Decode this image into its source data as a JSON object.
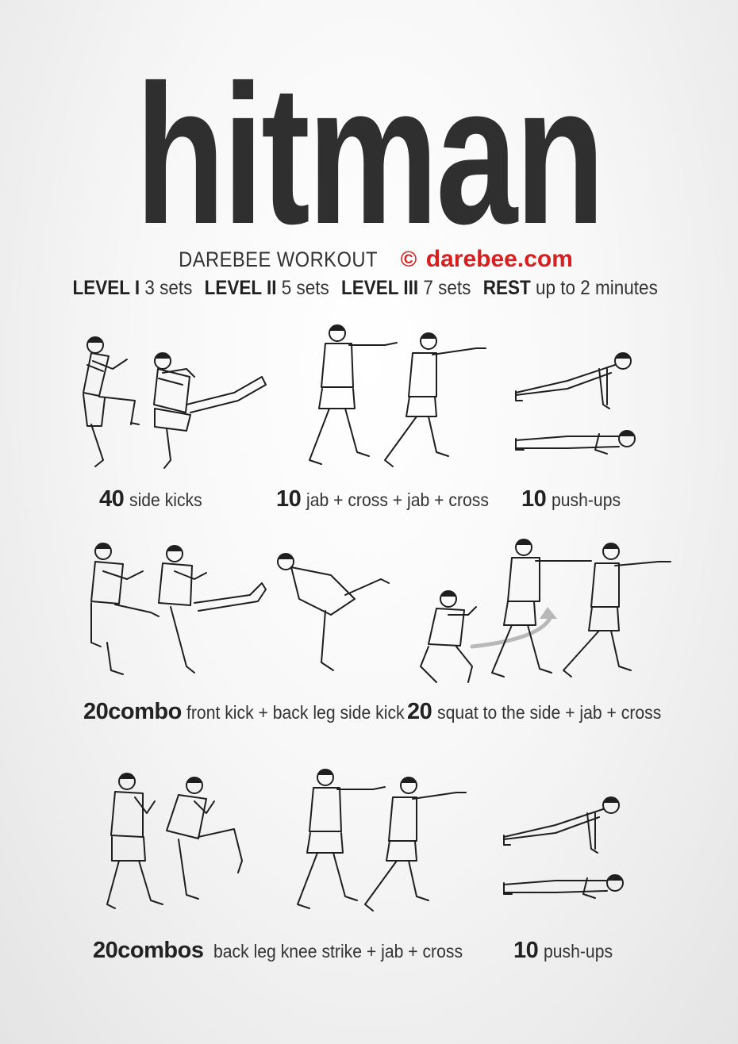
{
  "title": "hitman",
  "header": {
    "workout_label": "DAREBEE WORKOUT",
    "copyright_symbol": "©",
    "site": "darebee.com",
    "accent_color": "#d81f1f"
  },
  "levels": [
    {
      "label": "LEVEL I",
      "value": "3 sets"
    },
    {
      "label": "LEVEL II",
      "value": "5 sets"
    },
    {
      "label": "LEVEL III",
      "value": "7 sets"
    },
    {
      "label": "REST",
      "value": "up to 2 minutes"
    }
  ],
  "exercises": [
    {
      "count": "40",
      "name": "side kicks"
    },
    {
      "count": "10",
      "name": "jab + cross + jab + cross"
    },
    {
      "count": "10",
      "name": "push-ups"
    },
    {
      "count": "20combo",
      "name": "front kick + back leg side kick"
    },
    {
      "count": "20",
      "name": "squat to the side + jab + cross"
    },
    {
      "count": "20combos",
      "name": "back leg knee strike + jab + cross"
    },
    {
      "count": "10",
      "name": "push-ups"
    }
  ]
}
